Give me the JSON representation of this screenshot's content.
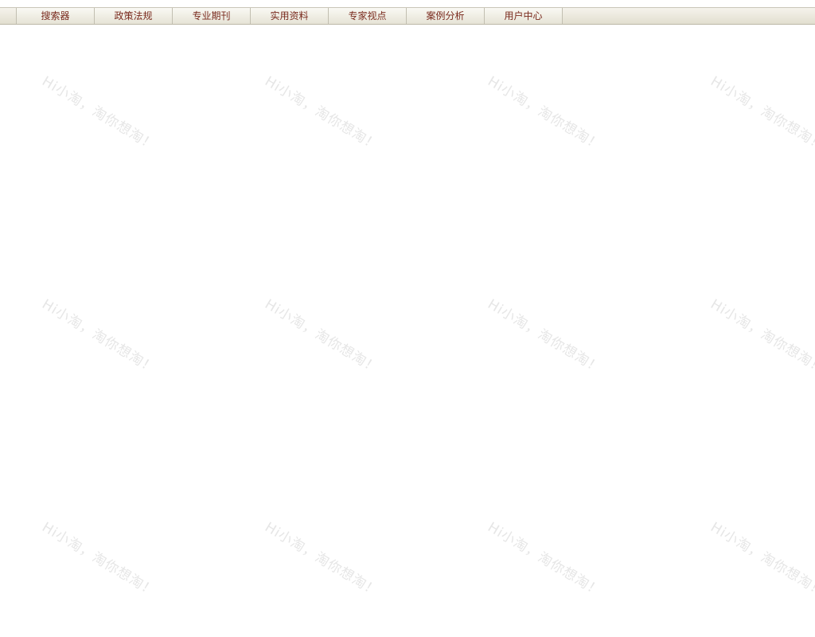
{
  "nav": {
    "tabs": [
      {
        "id": "search",
        "label": "搜索器"
      },
      {
        "id": "policy",
        "label": "政策法规"
      },
      {
        "id": "journal",
        "label": "专业期刊"
      },
      {
        "id": "materials",
        "label": "实用资料"
      },
      {
        "id": "experts",
        "label": "专家视点"
      },
      {
        "id": "cases",
        "label": "案例分析"
      },
      {
        "id": "user",
        "label": "用户中心"
      }
    ],
    "text_color": "#7a2b1e"
  },
  "watermark": {
    "text": "Hi小淘，淘你想淘！",
    "color": "#e6e6e6"
  }
}
